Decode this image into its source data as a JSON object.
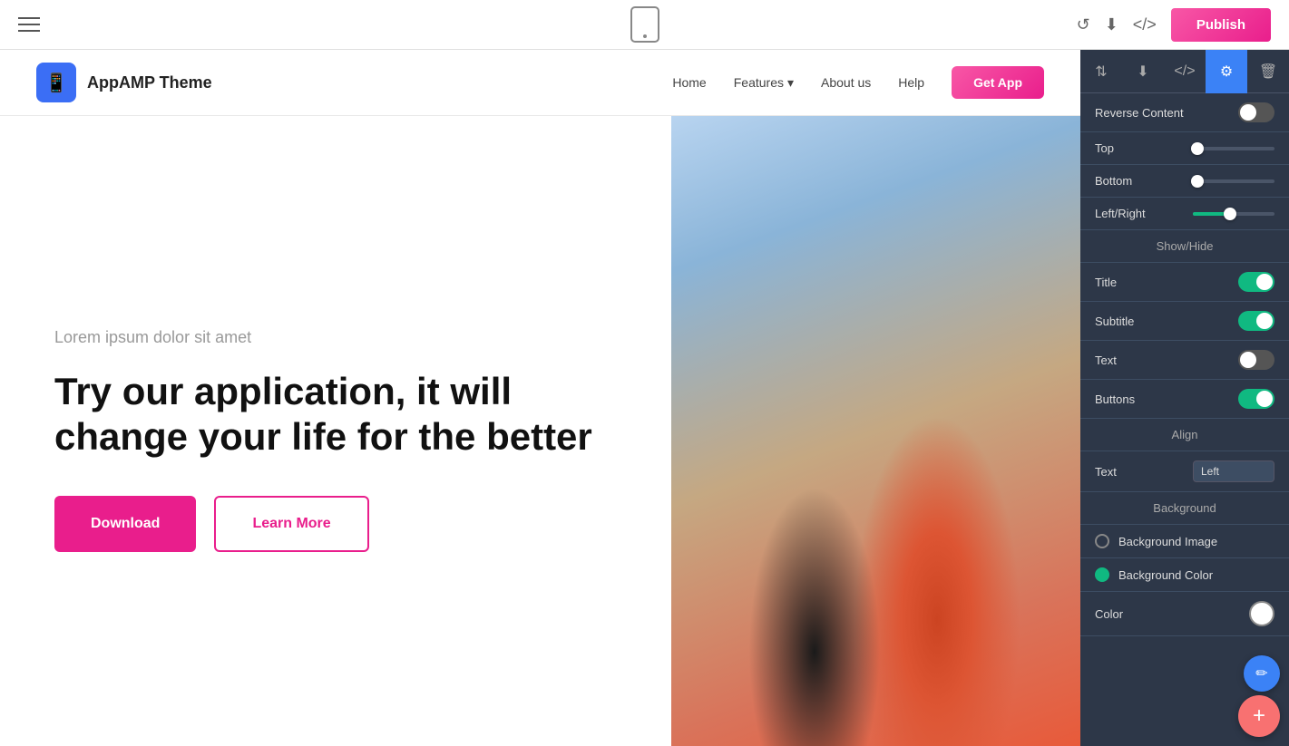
{
  "toolbar": {
    "publish_label": "Publish"
  },
  "navbar": {
    "logo_text": "AppAMP Theme",
    "nav_links": [
      {
        "label": "Home"
      },
      {
        "label": "Features",
        "has_dropdown": true
      },
      {
        "label": "About us"
      },
      {
        "label": "Help"
      }
    ],
    "cta_label": "Get App"
  },
  "hero": {
    "subtitle": "Lorem ipsum dolor sit amet",
    "title": "Try our application, it will change your life for the better",
    "btn_download": "Download",
    "btn_learn_more": "Learn More"
  },
  "panel": {
    "reverse_content_label": "Reverse Content",
    "top_label": "Top",
    "bottom_label": "Bottom",
    "left_right_label": "Left/Right",
    "show_hide_label": "Show/Hide",
    "title_label": "Title",
    "subtitle_label": "Subtitle",
    "text_label": "Text",
    "buttons_label": "Buttons",
    "align_label": "Align",
    "text_align_label": "Text",
    "text_align_value": "Left",
    "background_label": "Background",
    "bg_image_label": "Background Image",
    "bg_color_label": "Background Color",
    "color_label": "Color",
    "top_slider_pct": 5,
    "bottom_slider_pct": 5,
    "left_right_slider_pct": 45
  }
}
